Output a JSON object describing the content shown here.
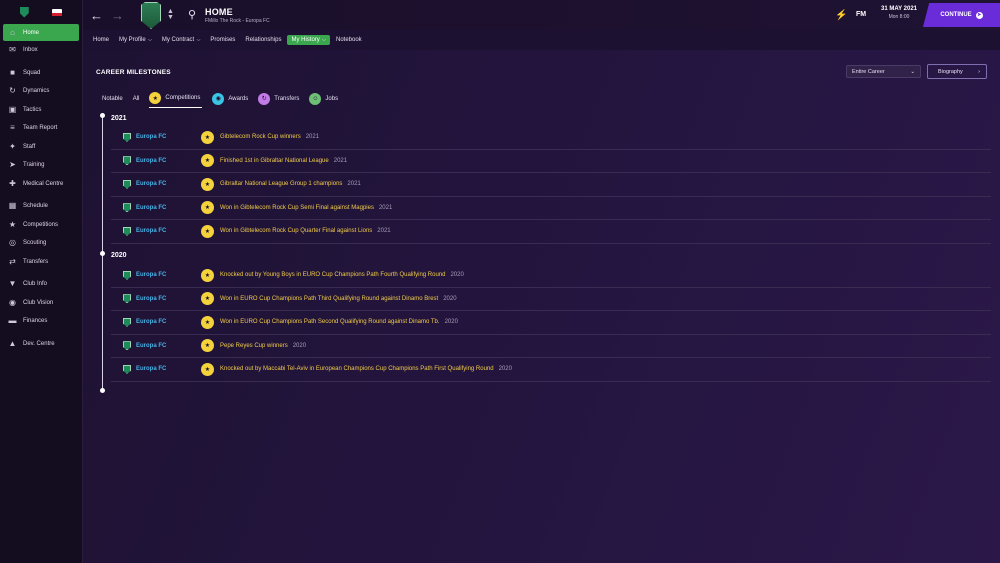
{
  "sidebar": {
    "items": [
      {
        "label": "Home",
        "icon": "home-icon",
        "active": true
      },
      {
        "label": "Inbox",
        "icon": "inbox-icon"
      },
      {
        "label": "Squad",
        "icon": "shirt-icon"
      },
      {
        "label": "Dynamics",
        "icon": "dynamics-icon"
      },
      {
        "label": "Tactics",
        "icon": "tactics-icon"
      },
      {
        "label": "Team Report",
        "icon": "report-icon"
      },
      {
        "label": "Staff",
        "icon": "staff-icon"
      },
      {
        "label": "Training",
        "icon": "training-icon"
      },
      {
        "label": "Medical Centre",
        "icon": "medical-icon"
      },
      {
        "label": "Schedule",
        "icon": "calendar-icon"
      },
      {
        "label": "Competitions",
        "icon": "trophy-icon"
      },
      {
        "label": "Scouting",
        "icon": "scouting-icon"
      },
      {
        "label": "Transfers",
        "icon": "transfers-icon"
      },
      {
        "label": "Club Info",
        "icon": "shield-icon"
      },
      {
        "label": "Club Vision",
        "icon": "vision-icon"
      },
      {
        "label": "Finances",
        "icon": "finances-icon"
      },
      {
        "label": "Dev. Centre",
        "icon": "dev-centre-icon"
      }
    ]
  },
  "header": {
    "title": "HOME",
    "subtitle": "FMillo The Rock - Europa FC",
    "fm_label": "FM",
    "date": "31 MAY 2021",
    "day_time": "Mon 8:00",
    "continue_label": "CONTINUE"
  },
  "subnav": {
    "items": [
      {
        "label": "Home",
        "dropdown": false
      },
      {
        "label": "My Profile",
        "dropdown": true
      },
      {
        "label": "My Contract",
        "dropdown": true
      },
      {
        "label": "Promises",
        "dropdown": false
      },
      {
        "label": "Relationships",
        "dropdown": false
      },
      {
        "label": "My History",
        "dropdown": true,
        "active": true
      },
      {
        "label": "Notebook",
        "dropdown": false
      }
    ]
  },
  "main": {
    "title": "CAREER MILESTONES",
    "period_select": "Entire Career",
    "biography_label": "Biography",
    "filters": {
      "notable": "Notable",
      "all": "All",
      "competitions": "Competitions",
      "awards": "Awards",
      "transfers": "Transfers",
      "jobs": "Jobs"
    }
  },
  "timeline": [
    {
      "year": "2021",
      "entries": [
        {
          "club": "Europa FC",
          "text": "Gibtelecom Rock Cup winners",
          "year": "2021"
        },
        {
          "club": "Europa FC",
          "text": "Finished 1st in Gibraltar National League",
          "year": "2021"
        },
        {
          "club": "Europa FC",
          "text": "Gibraltar National League Group 1 champions",
          "year": "2021"
        },
        {
          "club": "Europa FC",
          "text": "Won in Gibtelecom Rock Cup Semi Final against Magpies",
          "year": "2021"
        },
        {
          "club": "Europa FC",
          "text": "Won in Gibtelecom Rock Cup Quarter Final against Lions",
          "year": "2021"
        }
      ]
    },
    {
      "year": "2020",
      "entries": [
        {
          "club": "Europa FC",
          "text": "Knocked out by Young Boys in EURO Cup Champions Path Fourth Qualifying Round",
          "year": "2020"
        },
        {
          "club": "Europa FC",
          "text": "Won in EURO Cup Champions Path Third Qualifying Round against Dinamo Brest",
          "year": "2020"
        },
        {
          "club": "Europa FC",
          "text": "Won in EURO Cup Champions Path Second Qualifying Round against Dinamo Tb.",
          "year": "2020"
        },
        {
          "club": "Europa FC",
          "text": "Pepe Reyes Cup winners",
          "year": "2020"
        },
        {
          "club": "Europa FC",
          "text": "Knocked out by Maccabi Tel-Aviv in European Champions Cup Champions Path First Qualifying Round",
          "year": "2020"
        }
      ]
    }
  ],
  "colors": {
    "accent_green": "#3aa64e",
    "continue_purple": "#6a2bd9",
    "club_link_blue": "#46b2e6",
    "milestone_gold": "#f1cc48"
  }
}
